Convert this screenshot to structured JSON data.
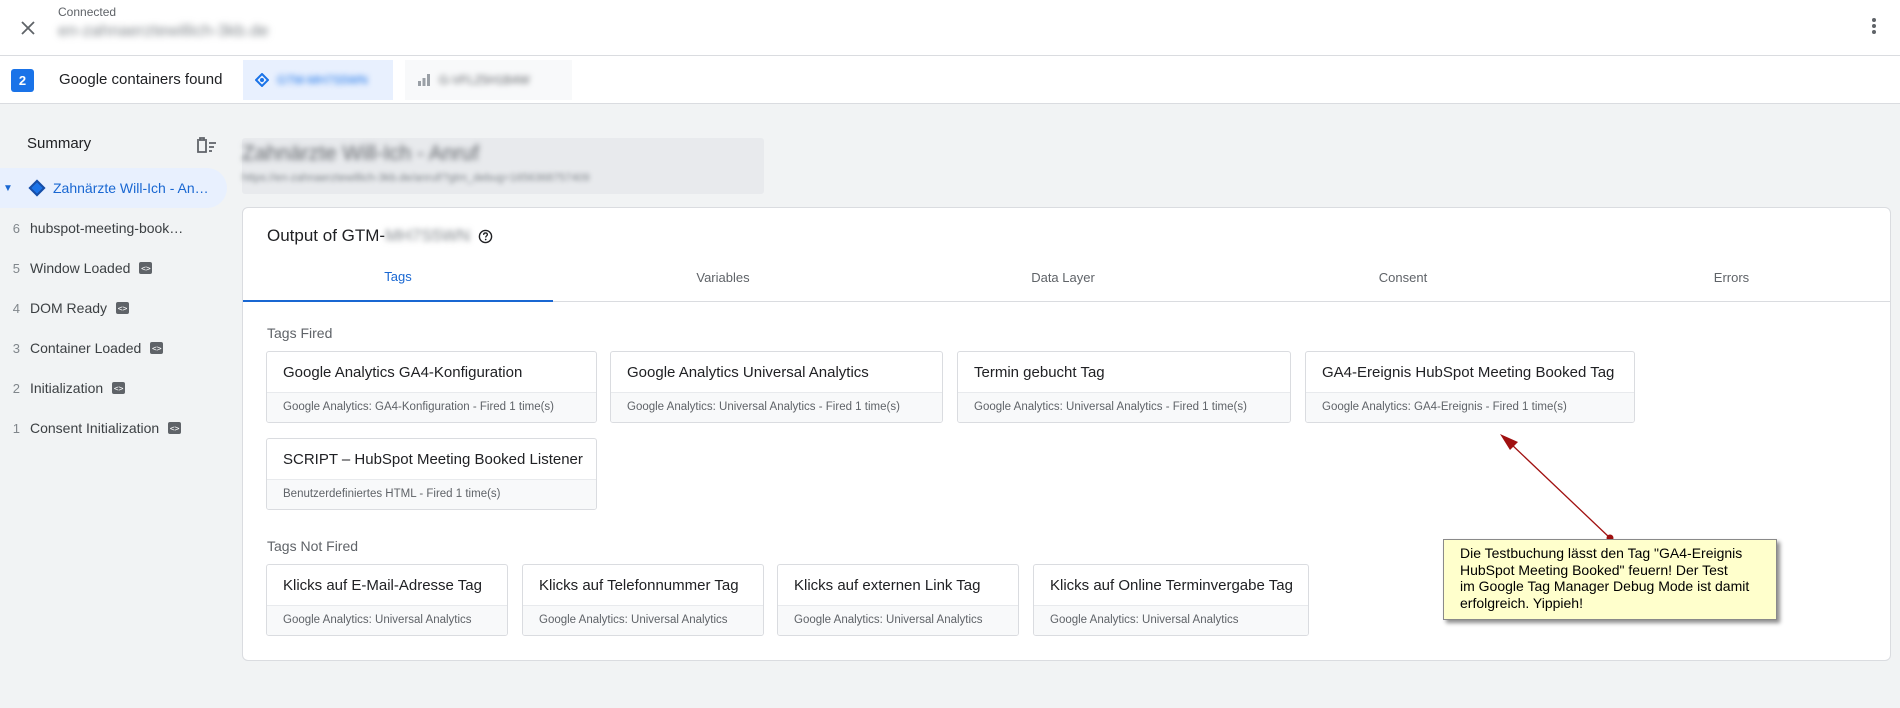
{
  "topbar": {
    "connected_label": "Connected",
    "url": "en-zahnaerztewillich-3kb.de"
  },
  "containers": {
    "count": "2",
    "found_label": "Google containers found",
    "tabs": [
      {
        "icon": "gtm-icon",
        "label": "GTM-MH7S5WN"
      },
      {
        "icon": "analytics-icon",
        "label": "G-VFLZ5H1B4W"
      }
    ]
  },
  "sidebar": {
    "summary_label": "Summary",
    "items": [
      {
        "num": "",
        "label": "Zahnärzte Will-Ich - An…",
        "active": true,
        "code": false
      },
      {
        "num": "6",
        "label": "hubspot-meeting-book…",
        "active": false,
        "code": false
      },
      {
        "num": "5",
        "label": "Window Loaded",
        "active": false,
        "code": true
      },
      {
        "num": "4",
        "label": "DOM Ready",
        "active": false,
        "code": true
      },
      {
        "num": "3",
        "label": "Container Loaded",
        "active": false,
        "code": true
      },
      {
        "num": "2",
        "label": "Initialization",
        "active": false,
        "code": true
      },
      {
        "num": "1",
        "label": "Consent Initialization",
        "active": false,
        "code": true
      }
    ]
  },
  "event": {
    "title": "Zahnärzte Will-Ich - Anruf",
    "url": "https://en-zahnaerztewillich-3kb.de/anruf/?gtm_debug=1656368757409"
  },
  "output": {
    "title_prefix": "Output of GTM-",
    "container_id": "MH7S5WN",
    "tabs": [
      "Tags",
      "Variables",
      "Data Layer",
      "Consent",
      "Errors"
    ]
  },
  "tags_fired": {
    "label": "Tags Fired",
    "items": [
      {
        "name": "Google Analytics GA4-Konfiguration",
        "meta": "Google Analytics: GA4-Konfiguration - Fired 1 time(s)"
      },
      {
        "name": "Google Analytics Universal Analytics",
        "meta": "Google Analytics: Universal Analytics - Fired 1 time(s)"
      },
      {
        "name": "Termin gebucht Tag",
        "meta": "Google Analytics: Universal Analytics - Fired 1 time(s)"
      },
      {
        "name": "GA4-Ereignis HubSpot Meeting Booked Tag",
        "meta": "Google Analytics: GA4-Ereignis - Fired 1 time(s)"
      },
      {
        "name": "SCRIPT – HubSpot Meeting Booked Listener",
        "meta": "Benutzerdefiniertes HTML - Fired 1 time(s)"
      }
    ]
  },
  "tags_not_fired": {
    "label": "Tags Not Fired",
    "items": [
      {
        "name": "Klicks auf E-Mail-Adresse Tag",
        "meta": "Google Analytics: Universal Analytics"
      },
      {
        "name": "Klicks auf Telefonnummer Tag",
        "meta": "Google Analytics: Universal Analytics"
      },
      {
        "name": "Klicks auf externen Link Tag",
        "meta": "Google Analytics: Universal Analytics"
      },
      {
        "name": "Klicks auf Online Terminvergabe Tag",
        "meta": "Google Analytics: Universal Analytics"
      }
    ]
  },
  "annotation": {
    "lines": [
      "Die Testbuchung lässt den Tag \"GA4-Ereignis",
      "HubSpot Meeting Booked\" feuern! Der Test",
      "im Google Tag Manager Debug Mode ist damit",
      "erfolgreich. Yippieh!"
    ],
    "arrow_color": "#a01010"
  },
  "colors": {
    "accent": "#1a73e8",
    "active_bg": "#e8f0fe",
    "note_bg": "#ffffcc"
  }
}
